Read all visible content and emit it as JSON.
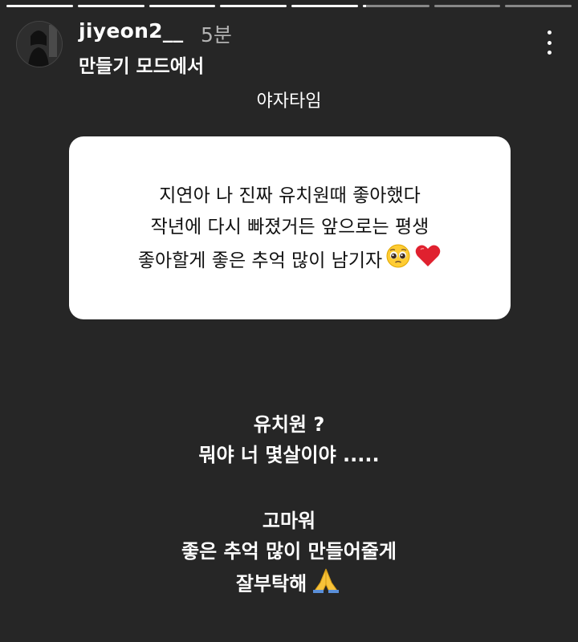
{
  "story": {
    "progress_segments": [
      1,
      1,
      1,
      1,
      1,
      0.05,
      0,
      0
    ]
  },
  "header": {
    "username": "jiyeon2__",
    "timestamp": "5분",
    "mode": "만들기 모드에서",
    "avatar_icon": "profile-avatar",
    "more_icon": "more-vertical-icon"
  },
  "question": {
    "label": "야자타임",
    "lines": [
      "지연아 나 진짜 유치원때 좋아했다",
      "작년에 다시 빠졌거든 앞으로는 평생",
      "좋아할게 좋은 추억 많이 남기자"
    ],
    "emojis": [
      "pleading-face-emoji",
      "red-heart-emoji"
    ]
  },
  "answer": {
    "lines": [
      "유치원 ?",
      "뭐야 너 몇살이야 .....",
      "",
      "고마워",
      "좋은 추억 많이 만들어줄게",
      "잘부탁해"
    ],
    "emoji": "folded-hands-emoji"
  }
}
